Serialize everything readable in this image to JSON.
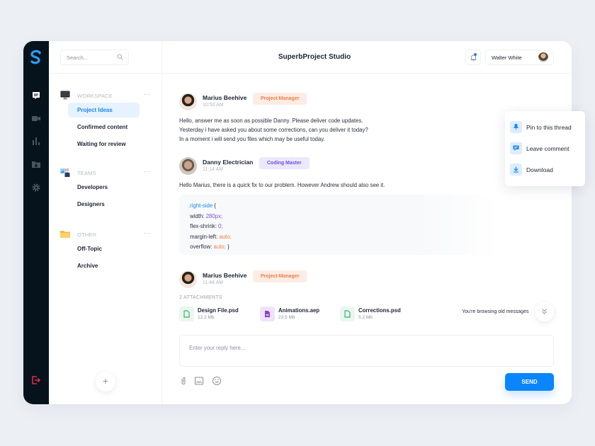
{
  "app": {
    "title": "SuperbProject Studio"
  },
  "rail": {
    "items": [
      {
        "icon": "chat-icon",
        "active": true
      },
      {
        "icon": "video-icon",
        "active": false
      },
      {
        "icon": "bar-chart-icon",
        "active": false
      },
      {
        "icon": "folder-download-icon",
        "active": false
      },
      {
        "icon": "gear-icon",
        "active": false
      }
    ],
    "logout_icon": "logout-icon"
  },
  "search": {
    "placeholder": "Search..."
  },
  "sidebar": {
    "groups": [
      {
        "label": "WORKSPACE",
        "icon": "monitor-icon",
        "items": [
          "Project Ideas",
          "Confirmed content",
          "Waiting for review"
        ],
        "active": "Project Ideas"
      },
      {
        "label": "TEAMS",
        "icon": "team-presenter-icon",
        "items": [
          "Developers",
          "Designers"
        ]
      },
      {
        "label": "OTHER",
        "icon": "folder-icon",
        "items": [
          "Off-Topic",
          "Archive"
        ]
      }
    ],
    "more": "···",
    "add_label": "+"
  },
  "header": {
    "user_name": "Walter White",
    "notification_unread": true
  },
  "messages": [
    {
      "author": "Marius Beehive",
      "role": "Project Manager",
      "time": "10:50 AM",
      "lines": [
        "Hello, answer me as soon as possible Danny. Please deliver code updates.",
        "Yesterday i have asked you about some corrections, can you deliver it today?",
        "In a moment i will send you files which may be useful today."
      ]
    },
    {
      "author": "Danny Electrician",
      "role": "Coding Master",
      "time": "11:14 AM",
      "lines": [
        "Hello Marius, there is a quick fix to our problem. However Andrew should also see it."
      ],
      "code": {
        "selector": ".right-side",
        "open": " {",
        "props": [
          {
            "name": "width: ",
            "value": "280px",
            "type": "num"
          },
          {
            "name": "flex-shrink: ",
            "value": "0",
            "type": "num"
          },
          {
            "name": "margin-left: ",
            "value": "auto",
            "type": "kw"
          },
          {
            "name": "overflow: ",
            "value": "auto",
            "type": "kw"
          }
        ],
        "semicolon": ";",
        "close": " }"
      }
    },
    {
      "author": "Marius Beehive",
      "role": "Project Manager",
      "time": "11:48 AM",
      "attachments_label": "2 ATTACHMENTS",
      "attachments": [
        {
          "name": "Design File.psd",
          "size": "12.2 Mb",
          "color": "green"
        },
        {
          "name": "Animations.aep",
          "size": "23.5 Mb",
          "color": "purple"
        },
        {
          "name": "Corrections.psd",
          "size": "5.2 Mb",
          "color": "green"
        }
      ]
    }
  ],
  "browsing_notice": "You're browsing old messages",
  "composer": {
    "placeholder": "Enter your reply here...",
    "send_label": "SEND"
  },
  "context_menu": {
    "items": [
      {
        "label": "Pin to this thread",
        "icon": "pin-icon"
      },
      {
        "label": "Leave comment",
        "icon": "comment-icon"
      },
      {
        "label": "Download",
        "icon": "download-icon"
      }
    ]
  },
  "colors": {
    "accent": "#0a85fb",
    "rail": "#06131c",
    "pm_badge": "#f07d45",
    "coding_badge": "#6c4ed6",
    "logout": "#e0294a"
  }
}
